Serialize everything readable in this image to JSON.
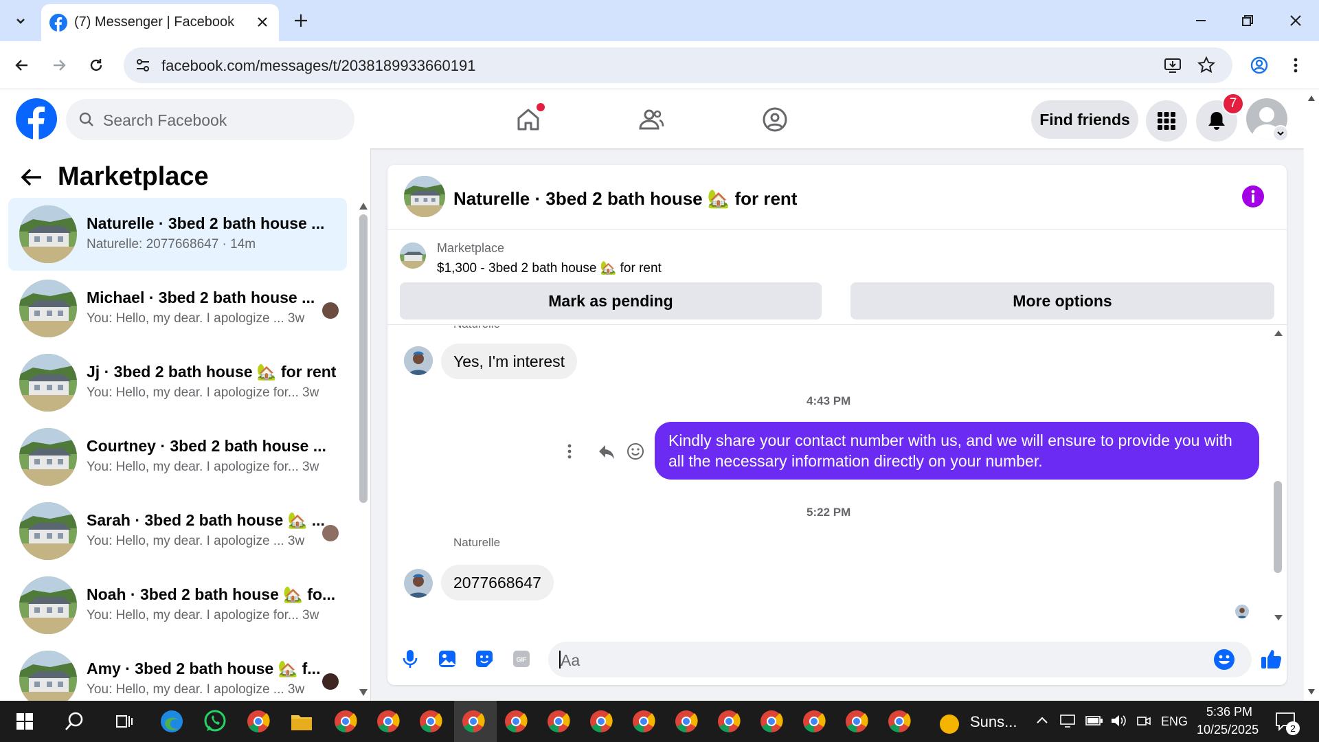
{
  "browser": {
    "tab_title": "(7) Messenger | Facebook",
    "url": "facebook.com/messages/t/2038189933660191"
  },
  "fb": {
    "search_placeholder": "Search Facebook",
    "find_friends": "Find friends",
    "notification_count": "7"
  },
  "sidebar": {
    "title": "Marketplace",
    "conversations": [
      {
        "name": "Naturelle · 3bed 2 bath house ...",
        "snippet": "Naturelle: 2077668647 · 14m",
        "active": true
      },
      {
        "name": "Michael · 3bed 2 bath house ...",
        "snippet": "You: Hello, my dear. I apologize ...  3w"
      },
      {
        "name": "Jj · 3bed 2 bath house 🏡 for rent",
        "snippet": "You: Hello, my dear. I apologize for...  3w"
      },
      {
        "name": "Courtney · 3bed 2 bath house ...",
        "snippet": "You: Hello, my dear. I apologize for...  3w"
      },
      {
        "name": "Sarah · 3bed 2 bath house 🏡 ...",
        "snippet": "You: Hello, my dear. I apologize ...  3w"
      },
      {
        "name": "Noah · 3bed 2 bath house 🏡 fo...",
        "snippet": "You: Hello, my dear. I apologize for...  3w"
      },
      {
        "name": "Amy · 3bed 2 bath house 🏡 f...",
        "snippet": "You: Hello, my dear. I apologize ...  3w"
      }
    ]
  },
  "chat": {
    "title": "Naturelle · 3bed 2 bath house 🏡 for rent",
    "listing_source": "Marketplace",
    "listing_title": "$1,300 - 3bed 2 bath house 🏡 for rent",
    "mark_pending": "Mark as pending",
    "more_options": "More options",
    "sender_top": "Naturelle",
    "msg1": "Yes, I'm interest",
    "time1": "4:43 PM",
    "msg2": "Kindly share your contact number with us, and we will ensure to provide you with all the necessary information directly on your number.",
    "time2": "5:22 PM",
    "sender_name": "Naturelle",
    "msg3": "2077668647",
    "input_placeholder": "Aa"
  },
  "taskbar": {
    "weather": "Suns...",
    "lang": "ENG",
    "time": "5:36 PM",
    "date": "10/25/2025",
    "notif": "2"
  }
}
